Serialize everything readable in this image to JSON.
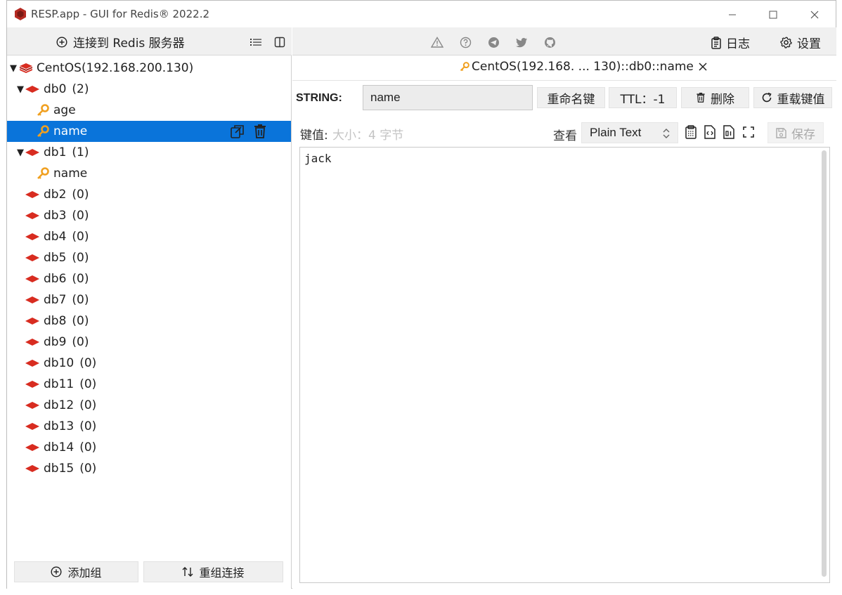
{
  "window": {
    "title": "RESP.app - GUI for Redis® 2022.2",
    "controls": {
      "minimize": "—",
      "maximize": "☐",
      "close": "✕"
    }
  },
  "left_toolbar": {
    "connect_label": "连接到 Redis 服务器",
    "icons": [
      "plus-circle-icon",
      "list-icon",
      "columns-icon"
    ]
  },
  "tree": {
    "server": "CentOS(192.168.200.130)",
    "databases": [
      {
        "name": "db0",
        "count": "(2)",
        "expanded": true,
        "keys": [
          "age",
          "name"
        ]
      },
      {
        "name": "db1",
        "count": "(1)",
        "expanded": true,
        "keys": [
          "name"
        ]
      },
      {
        "name": "db2",
        "count": "(0)"
      },
      {
        "name": "db3",
        "count": "(0)"
      },
      {
        "name": "db4",
        "count": "(0)"
      },
      {
        "name": "db5",
        "count": "(0)"
      },
      {
        "name": "db6",
        "count": "(0)"
      },
      {
        "name": "db7",
        "count": "(0)"
      },
      {
        "name": "db8",
        "count": "(0)"
      },
      {
        "name": "db9",
        "count": "(0)"
      },
      {
        "name": "db10",
        "count": "(0)"
      },
      {
        "name": "db11",
        "count": "(0)"
      },
      {
        "name": "db12",
        "count": "(0)"
      },
      {
        "name": "db13",
        "count": "(0)"
      },
      {
        "name": "db14",
        "count": "(0)"
      },
      {
        "name": "db15",
        "count": "(0)"
      }
    ],
    "selected_key": "name"
  },
  "left_bottom": {
    "add_group": "添加组",
    "reorder": "重组连接"
  },
  "right_toolbar": {
    "icons": [
      "warning-icon",
      "help-icon",
      "telegram-icon",
      "twitter-icon",
      "github-icon"
    ],
    "log_label": "日志",
    "settings_label": "设置"
  },
  "tab": {
    "label": "CentOS(192.168. ... 130)::db0::name",
    "close": "✕"
  },
  "key_editor": {
    "type_label": "STRING:",
    "key_name": "name",
    "rename_label": "重命名键",
    "ttl_label": "TTL：-1",
    "delete_label": "删除",
    "reload_label": "重载键值",
    "value_label": "键值:",
    "size_label": "大小：4 字节",
    "view_label": "查看",
    "view_mode": "Plain Text",
    "save_label": "保存",
    "value": "jack"
  },
  "colors": {
    "selection": "#0a74da",
    "redis_red": "#d82c20",
    "key_orange": "#f0a020",
    "toolbar_bg": "#f0f0f0"
  }
}
